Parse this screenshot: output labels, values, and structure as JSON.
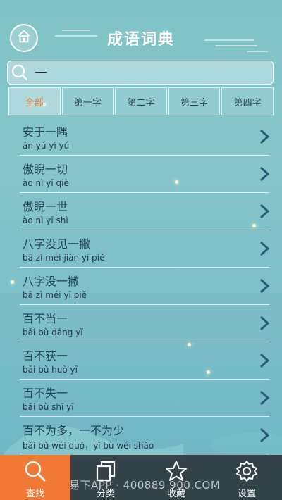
{
  "header": {
    "title": "成语词典",
    "home_icon": "home-icon"
  },
  "search": {
    "value": "一",
    "icon": "search-icon"
  },
  "tabs": [
    {
      "label": "全部",
      "active": true
    },
    {
      "label": "第一字",
      "active": false
    },
    {
      "label": "第二字",
      "active": false
    },
    {
      "label": "第三字",
      "active": false
    },
    {
      "label": "第四字",
      "active": false
    }
  ],
  "list": [
    {
      "idiom": "安于一隅",
      "pinyin": "ān yú yī yú"
    },
    {
      "idiom": "傲睨一切",
      "pinyin": "ào nì yī qiè"
    },
    {
      "idiom": "傲睨一世",
      "pinyin": "ào nì yī shì"
    },
    {
      "idiom": "八字没见一撇",
      "pinyin": "bā zì méi jiàn yī piě"
    },
    {
      "idiom": "八字没一撇",
      "pinyin": "bā zì méi yī piě"
    },
    {
      "idiom": "百不当一",
      "pinyin": "bǎi bù dāng yī"
    },
    {
      "idiom": "百不获一",
      "pinyin": "bǎi bù huò yī"
    },
    {
      "idiom": "百不失一",
      "pinyin": "bǎi bù shī yī"
    },
    {
      "idiom": "百不为多，一不为少",
      "pinyin": "bǎi bù wéi duō，yī bù wéi shǎo"
    }
  ],
  "nav": [
    {
      "label": "查找",
      "icon": "search-icon",
      "active": true
    },
    {
      "label": "分类",
      "icon": "copy-icon",
      "active": false
    },
    {
      "label": "收藏",
      "icon": "star-icon",
      "active": false
    },
    {
      "label": "设置",
      "icon": "gear-icon",
      "active": false
    }
  ],
  "watermark": "易下APP · 400889 900.COM",
  "colors": {
    "accent": "#f07a35",
    "text": "#1f3f55",
    "chevron": "#2a5a78"
  }
}
